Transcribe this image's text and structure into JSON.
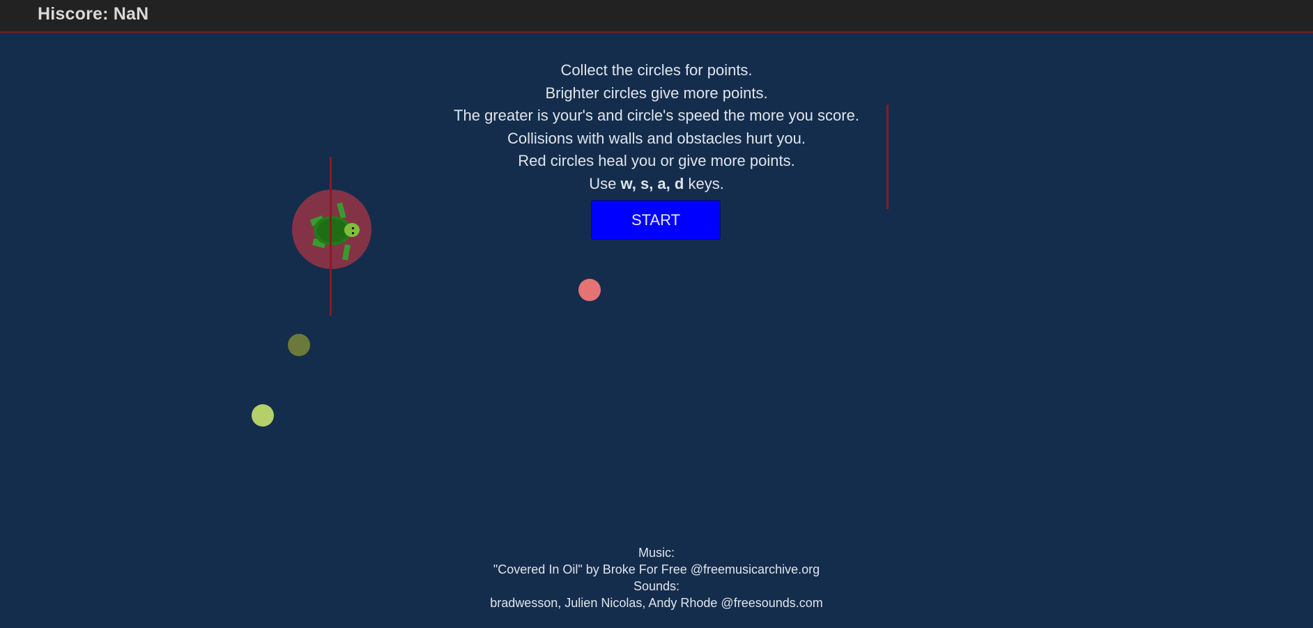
{
  "header": {
    "hiscore_label": "Hiscore: NaN"
  },
  "instructions": {
    "line1": "Collect the circles for points.",
    "line2": "Brighter circles give more points.",
    "line3": "The greater is your's and circle's speed the more you score.",
    "line4": "Collisions with walls and obstacles hurt you.",
    "line5": "Red circles heal you or give more points.",
    "line6_prefix": "Use",
    "line6_keys": "w, s, a, d",
    "line6_suffix": "keys."
  },
  "start_button": {
    "label": "START"
  },
  "credits": {
    "music_label": "Music:",
    "music_credit": "\"Covered In Oil\" by Broke For Free @freemusicarchive.org",
    "sounds_label": "Sounds:",
    "sounds_credit": "bradwesson, Julien Nicolas, Andy Rhode @freesounds.com"
  },
  "colors": {
    "background": "#142d4c",
    "topbar": "#222222",
    "accent_red": "#7a1c24",
    "start_button": "#0000ff",
    "circle_red": "#e57373",
    "circle_olive": "#6b7a3a",
    "circle_lime": "#b5cf6b",
    "turtle_green": "#2e8b22",
    "obstacle": "#8b1a22"
  },
  "game_objects": {
    "player": "turtle-icon",
    "collectibles": [
      "red-circle",
      "olive-circle",
      "lime-circle"
    ],
    "obstacles": [
      "vertical-wall",
      "vertical-wall"
    ]
  }
}
